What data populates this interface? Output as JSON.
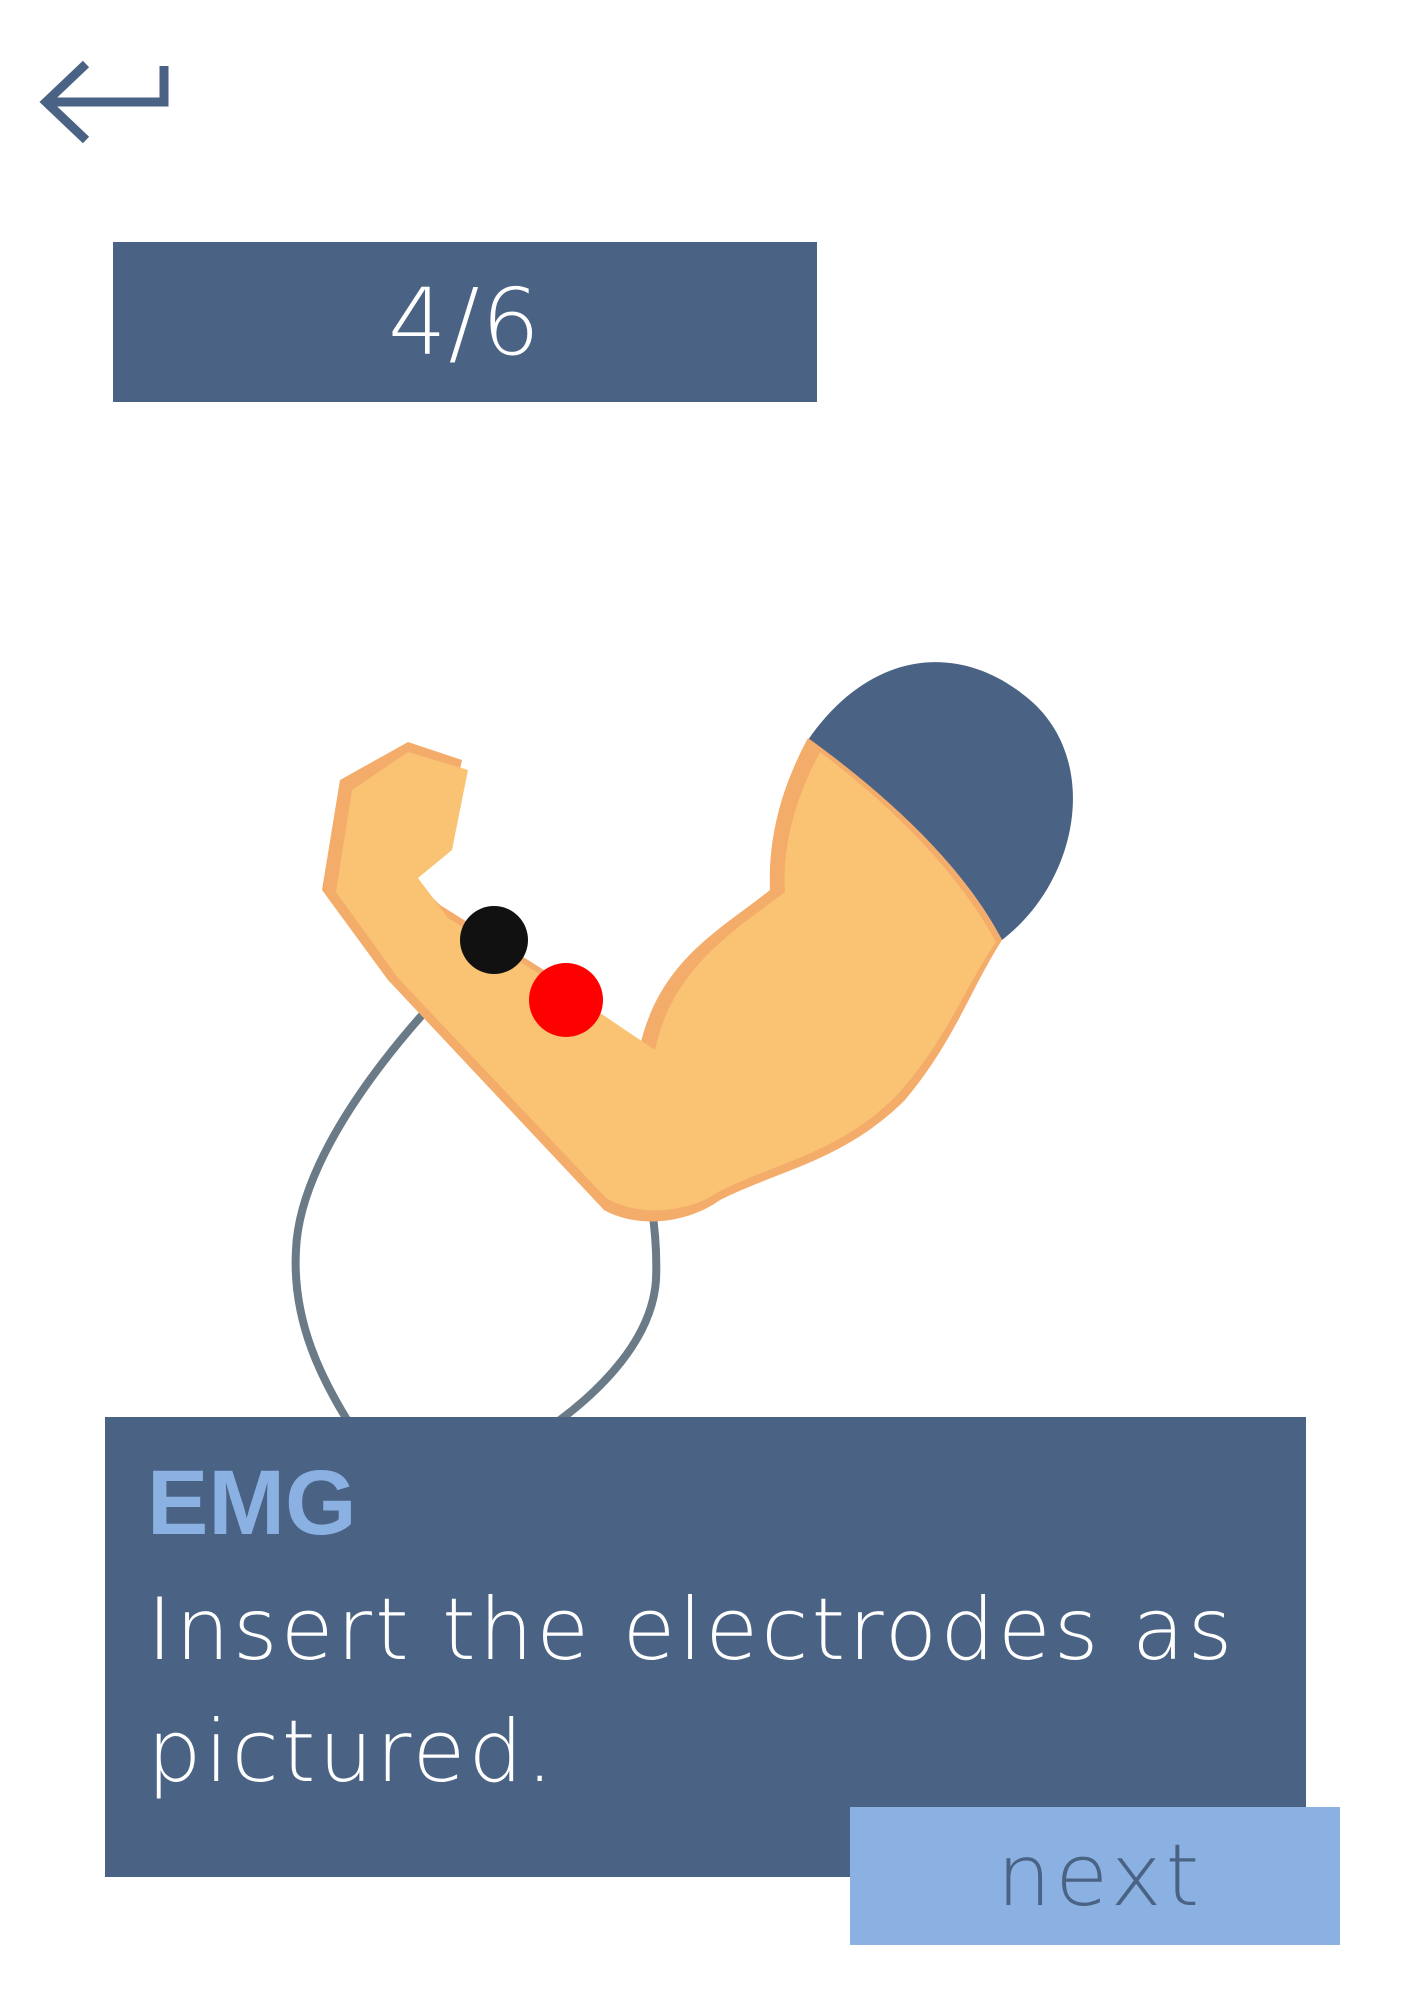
{
  "header": {
    "back_icon": "return-arrow-icon",
    "step_indicator": "4/6"
  },
  "illustration": {
    "subject": "flexed-arm",
    "electrodes": [
      {
        "color": "#111111",
        "name": "black-electrode"
      },
      {
        "color": "#ff0000",
        "name": "red-electrode"
      }
    ],
    "skin_color": "#f9c373",
    "skin_shade": "#f4ac6b",
    "sleeve_color": "#4a6283",
    "wire_color": "#6b7a87"
  },
  "card": {
    "title": "EMG",
    "instruction": "Insert the electrodes as pictured."
  },
  "actions": {
    "next_label": "next"
  },
  "colors": {
    "primary": "#4a6283",
    "accent": "#8ab1e1",
    "background": "#ffffff"
  }
}
